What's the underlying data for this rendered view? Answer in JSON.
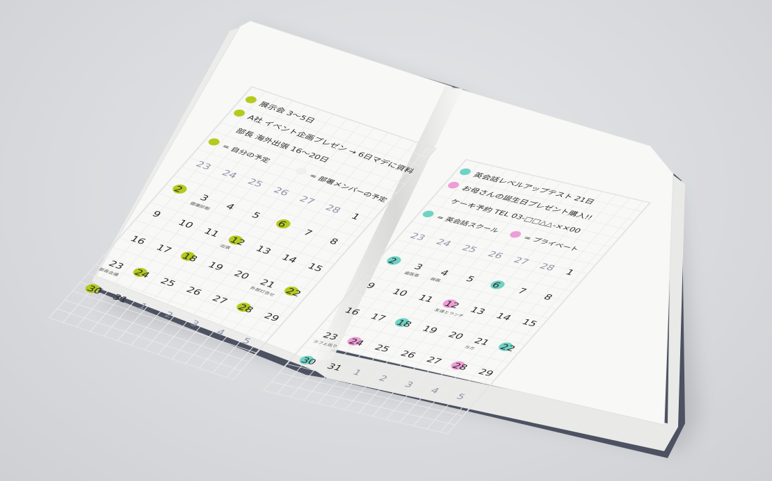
{
  "colors": {
    "green_dot": "#b5c91e",
    "teal_dot": "#6fd3c4",
    "pink_dot": "#ec9ed6",
    "paper": "#f7f7f5",
    "ink": "#2b2b2b",
    "grey_date": "#8e93a8"
  },
  "left_page": {
    "notes": [
      "展示会 3～5日",
      "A社 イベント企画プレゼン → 6日マデに資料",
      "部長 海外出張 16～20日"
    ],
    "legend": {
      "self": "= 自分の予定",
      "team": "= 部署メンバーの予定"
    },
    "calendar_rows": [
      [
        "23",
        "24",
        "25",
        "26",
        "27",
        "28",
        "1"
      ],
      [
        "2",
        "3",
        "4",
        "5",
        "6",
        "7",
        "8"
      ],
      [
        "9",
        "10",
        "11",
        "12",
        "13",
        "14",
        "15"
      ],
      [
        "16",
        "17",
        "18",
        "19",
        "20",
        "21",
        "22"
      ],
      [
        "23",
        "24",
        "25",
        "26",
        "27",
        "28",
        "29"
      ],
      [
        "30",
        "31",
        "1",
        "2",
        "3",
        "4",
        "5"
      ]
    ],
    "cell_notes": [
      "健康診断",
      "出張",
      "外部打合せ",
      "部長会議"
    ]
  },
  "right_page": {
    "notes": [
      "英会話レベルアップテスト 21日",
      "お母さんの誕生日プレゼント購入!!",
      "ケーキ予約 TEL 03-□□△△-××00"
    ],
    "legend": {
      "lesson": "= 英会話スクール",
      "private": "= プライベート"
    },
    "calendar_rows": [
      [
        "23",
        "24",
        "25",
        "26",
        "27",
        "28",
        "1"
      ],
      [
        "2",
        "3",
        "4",
        "5",
        "6",
        "7",
        "8"
      ],
      [
        "9",
        "10",
        "11",
        "12",
        "13",
        "14",
        "15"
      ],
      [
        "16",
        "17",
        "18",
        "19",
        "20",
        "21",
        "22"
      ],
      [
        "23",
        "24",
        "25",
        "26",
        "27",
        "28",
        "29"
      ],
      [
        "30",
        "31",
        "1",
        "2",
        "3",
        "4",
        "5"
      ]
    ],
    "cell_notes": [
      "歯医者",
      "友達とランチ",
      "ヨガ",
      "カフェ巡り",
      "映画"
    ]
  }
}
